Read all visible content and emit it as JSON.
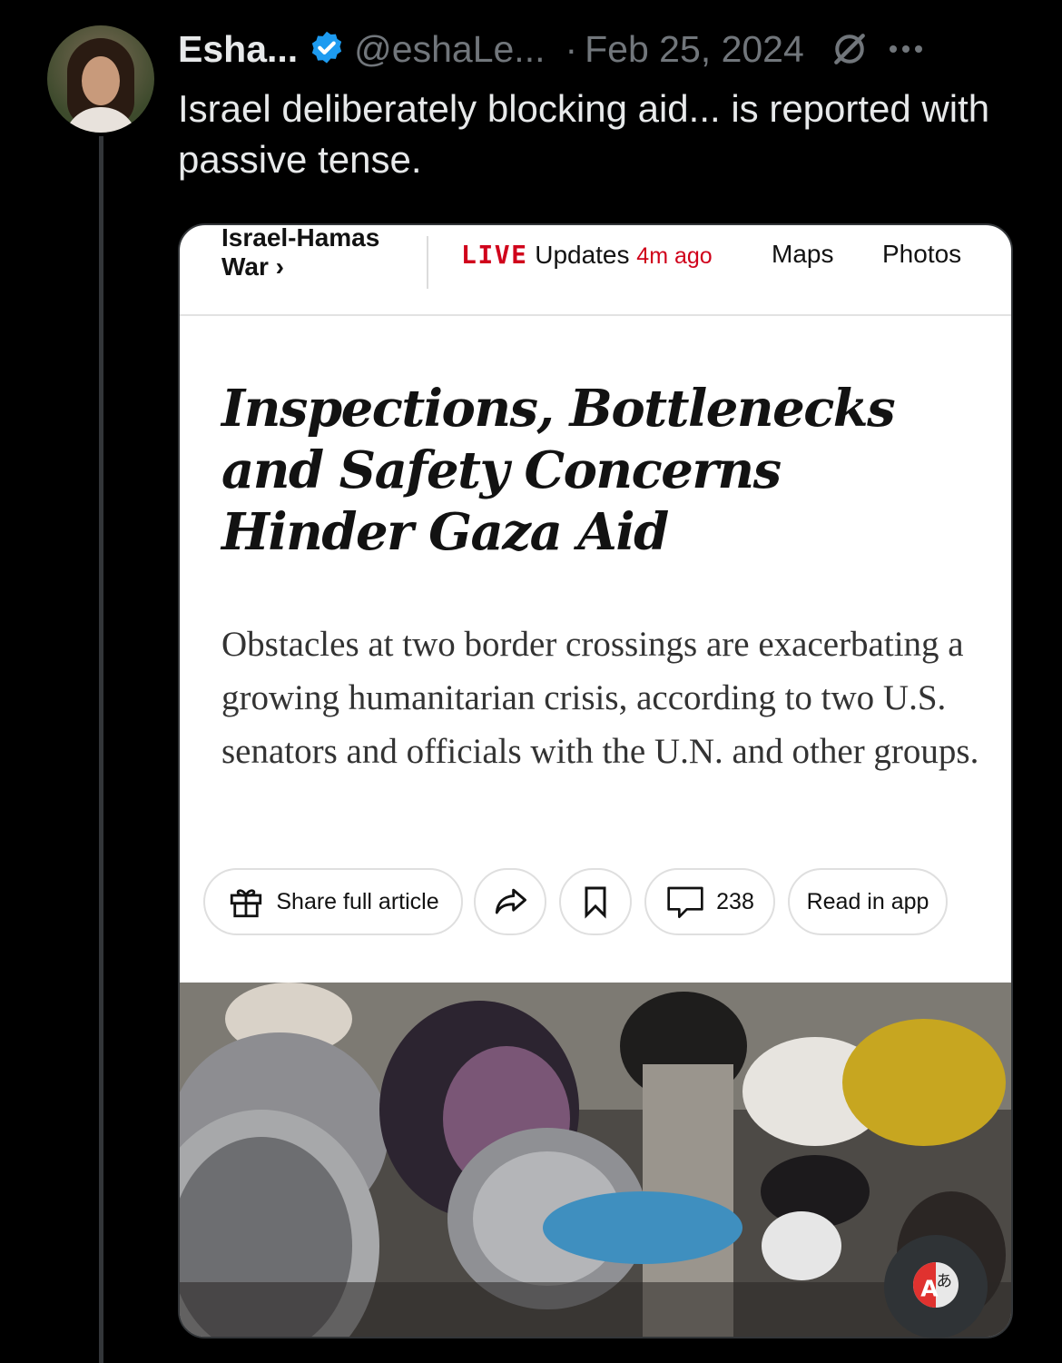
{
  "tweet": {
    "author_name": "Esha...",
    "handle": "@eshaLe...",
    "separator": "·",
    "date": "Feb 25, 2024",
    "text": "Israel deliberately blocking aid... is reported with passive tense."
  },
  "article": {
    "section": "Israel-Hamas War ›",
    "live_badge": "LIVE",
    "live_label": "Updates",
    "live_time": "4m ago",
    "nav_maps": "Maps",
    "nav_photos": "Photos",
    "headline": "Inspections, Bottlenecks and Safety Concerns Hinder Gaza Aid",
    "dek": "Obstacles at two border crossings are exacerbating a growing humanitarian crisis, according to two U.S. senators and officials with the U.N. and other groups.",
    "share_label": "Share full article",
    "comment_count": "238",
    "read_in_app": "Read in app"
  },
  "icons": {
    "verified": "verified-badge-icon",
    "grok": "grok-icon",
    "more": "more-icon",
    "gift": "gift-icon",
    "share": "share-arrow-icon",
    "bookmark": "bookmark-icon",
    "comment": "comment-icon",
    "translate": "translate-icon"
  },
  "colors": {
    "background": "#000000",
    "verified_blue": "#1d9bf0",
    "live_red": "#d0021b"
  }
}
